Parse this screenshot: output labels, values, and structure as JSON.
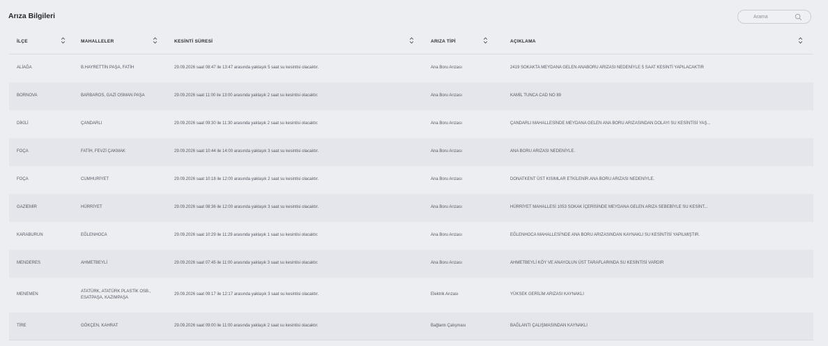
{
  "page": {
    "title": "Arıza Bilgileri"
  },
  "search": {
    "placeholder": "Arama"
  },
  "columns": [
    {
      "label": "İLÇE"
    },
    {
      "label": "MAHALLELER"
    },
    {
      "label": "KESİNTİ SÜRESİ"
    },
    {
      "label": "ARIZA TİPİ"
    },
    {
      "label": "AÇIKLAMA"
    }
  ],
  "rows": [
    {
      "ilce": "ALİAĞA",
      "mahalleler": "B.HAYRETTİN PAŞA, FATİH",
      "sure": "29.09.2026 saat 08:47 ile 13:47 arasında yaklaşık 5 saat su kesintisi olacaktır.",
      "tip": "Ana Boru Arızası",
      "aciklama": "2419 SOKAKTA MEYDANA GELEN ANABORU ARIZASI NEDENİYLE 5 SAAT KESİNTİ YAPILACAKTIR"
    },
    {
      "ilce": "BORNOVA",
      "mahalleler": "BARBAROS, GAZİ OSMAN PAŞA",
      "sure": "29.09.2026 saat 11:00 ile 13:00 arasında yaklaşık 2 saat su kesintisi olacaktır.",
      "tip": "Ana Boru Arızası",
      "aciklama": "KAMİL TUNCA CAD NO 89"
    },
    {
      "ilce": "DİKİLİ",
      "mahalleler": "ÇANDARLI",
      "sure": "29.09.2026 saat 09:30 ile 11:30 arasında yaklaşık 2 saat su kesintisi olacaktır.",
      "tip": "Ana Boru Arızası",
      "aciklama": "ÇANDARLI MAHALLESİNDE MEYDANA GELEN ANA BORU ARIZASINDAN DOLAYI SU KESİNTİSİ YAŞ..."
    },
    {
      "ilce": "FOÇA",
      "mahalleler": "FATİH, FEVZİ ÇAKMAK",
      "sure": "29.09.2026 saat 10:44 ile 14:00 arasında yaklaşık 3 saat su kesintisi olacaktır.",
      "tip": "Ana Boru Arızası",
      "aciklama": "ANA BORU ARIZASI NEDENİYLE."
    },
    {
      "ilce": "FOÇA",
      "mahalleler": "CUMHURİYET",
      "sure": "29.09.2026 saat 10:18 ile 12:00 arasında yaklaşık 2 saat su kesintisi olacaktır.",
      "tip": "Ana Boru Arızası",
      "aciklama": "DONATKENT ÜST KISIMLAR ETKİLENİR.ANA BORU ARIZASI NEDENİYLE."
    },
    {
      "ilce": "GAZİEMİR",
      "mahalleler": "HÜRRİYET",
      "sure": "29.09.2026 saat 08:36 ile 12:00 arasında yaklaşık 3 saat su kesintisi olacaktır.",
      "tip": "Ana Boru Arızası",
      "aciklama": "HÜRRİYET MAHALLESİ 1053 SOKAK İÇERİSİNDE MEYDANA GELEN ARIZA SEBEBİYLE SU KESİNT..."
    },
    {
      "ilce": "KARABURUN",
      "mahalleler": "EĞLENHOCA",
      "sure": "29.09.2026 saat 10:29 ile 11:29 arasında yaklaşık 1 saat su kesintisi olacaktır.",
      "tip": "Ana Boru Arızası",
      "aciklama": "EĞLENHOCA MAHALLESİ'NDE ANA BORU ARIZASINDAN KAYNAKLI SU KESİNTİSİ YAPILMIŞTIR."
    },
    {
      "ilce": "MENDERES",
      "mahalleler": "AHMETBEYLİ",
      "sure": "29.09.2026 saat 07:45 ile 11:00 arasında yaklaşık 3 saat su kesintisi olacaktır.",
      "tip": "Ana Boru Arızası",
      "aciklama": "AHMETBEYLİ KÖY VE ANAYOLUN ÜST TARAFLARINDA SU KESİNTİSİ VARDIR"
    },
    {
      "ilce": "MENEMEN",
      "mahalleler": "ATATÜRK, ATATÜRK PLASTİK OSB., ESATPAŞA, KAZIMPAŞA",
      "sure": "29.09.2026 saat 09:17 ile 12:17 arasında yaklaşık 3 saat su kesintisi olacaktır.",
      "tip": "Elektrik Arızası",
      "aciklama": "YÜKSEK GERİLİM ARIZASI KAYNAKLI"
    },
    {
      "ilce": "TİRE",
      "mahalleler": "GÖKÇEN, KAHRAT",
      "sure": "29.09.2026 saat 09:00 ile 11:00 arasında yaklaşık 2 saat su kesintisi olacaktır.",
      "tip": "Bağlantı Çalışması",
      "aciklama": "BAĞLANTI ÇALIŞMASINDAN KAYNAKLI"
    }
  ]
}
